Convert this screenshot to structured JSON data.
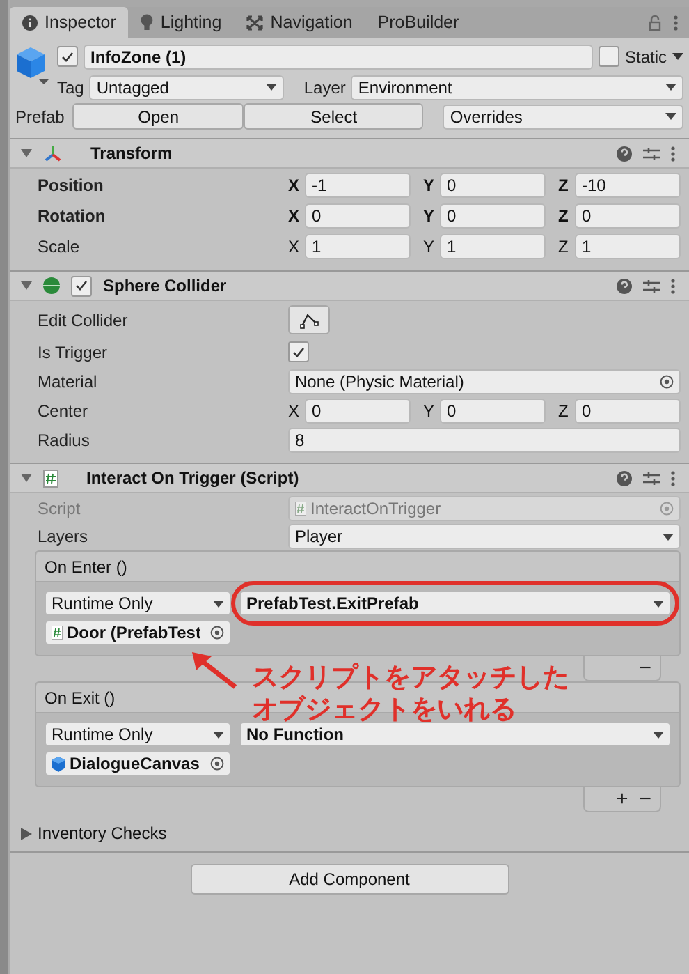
{
  "tabs": [
    {
      "label": "Inspector",
      "kind": "info",
      "selected": true
    },
    {
      "label": "Lighting",
      "kind": "bulb",
      "selected": false
    },
    {
      "label": "Navigation",
      "kind": "nav",
      "selected": false
    },
    {
      "label": "ProBuilder",
      "kind": "plain",
      "selected": false
    }
  ],
  "object": {
    "active": true,
    "name": "InfoZone (1)",
    "static": false,
    "static_label": "Static",
    "tag_label": "Tag",
    "tag": "Untagged",
    "layer_label": "Layer",
    "layer": "Environment",
    "prefab_label": "Prefab",
    "open": "Open",
    "select": "Select",
    "overrides": "Overrides"
  },
  "transform": {
    "title": "Transform",
    "expanded": true,
    "rows": [
      {
        "label": "Position",
        "modified": true,
        "values": [
          {
            "axis": "X",
            "value": "-1"
          },
          {
            "axis": "Y",
            "value": "0"
          },
          {
            "axis": "Z",
            "value": "-10"
          }
        ]
      },
      {
        "label": "Rotation",
        "modified": true,
        "values": [
          {
            "axis": "X",
            "value": "0"
          },
          {
            "axis": "Y",
            "value": "0"
          },
          {
            "axis": "Z",
            "value": "0"
          }
        ]
      },
      {
        "label": "Scale",
        "modified": false,
        "values": [
          {
            "axis": "X",
            "value": "1"
          },
          {
            "axis": "Y",
            "value": "1"
          },
          {
            "axis": "Z",
            "value": "1"
          }
        ]
      }
    ]
  },
  "sphere_collider": {
    "title": "Sphere Collider",
    "enabled": true,
    "expanded": true,
    "rows": [
      {
        "kind": "button",
        "label": "Edit Collider"
      },
      {
        "kind": "checkbox",
        "label": "Is Trigger",
        "checked": true
      },
      {
        "kind": "object",
        "label": "Material",
        "value": "None (Physic Material)"
      },
      {
        "kind": "vector",
        "label": "Center",
        "values": [
          {
            "axis": "X",
            "value": "0"
          },
          {
            "axis": "Y",
            "value": "0"
          },
          {
            "axis": "Z",
            "value": "0"
          }
        ]
      },
      {
        "kind": "text",
        "label": "Radius",
        "value": "8"
      }
    ]
  },
  "script_component": {
    "title": "Interact On Trigger (Script)",
    "expanded": true,
    "rows": [
      {
        "kind": "script",
        "label": "Script",
        "value": "InteractOnTrigger",
        "disabled": true
      },
      {
        "kind": "dropdown",
        "label": "Layers",
        "value": "Player",
        "disabled": false
      }
    ],
    "events": [
      {
        "title": "On Enter ()",
        "mode": "Runtime Only",
        "function": "PrefabTest.ExitPrefab",
        "target": "Door (PrefabTest",
        "kind": "script",
        "circled": true,
        "footer_buttons": [
          "−"
        ]
      },
      {
        "title": "On Exit ()",
        "mode": "Runtime Only",
        "function": "No Function",
        "target": "DialogueCanvas",
        "kind": "object",
        "circled": false,
        "footer_buttons": [
          "+",
          "−"
        ]
      }
    ]
  },
  "annotation": {
    "lines": [
      "スクリプトをアタッチした",
      "オブジェクトをいれる"
    ]
  },
  "foldout": {
    "label": "Inventory Checks",
    "expanded": false
  },
  "add_component": "Add Component"
}
